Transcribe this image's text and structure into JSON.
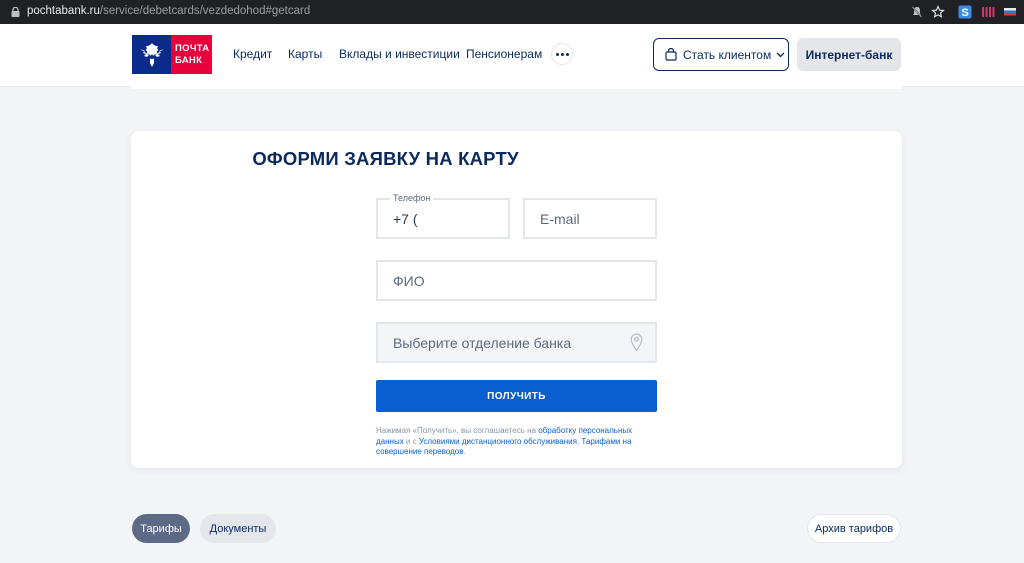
{
  "browser": {
    "url_host": "pochtabank.ru",
    "url_path": "/service/debetcards/vezdedohod#getcard"
  },
  "header": {
    "logo_line1": "ПОЧТА",
    "logo_line2": "БАНК",
    "nav": [
      "Кредит",
      "Карты",
      "Вклады и инвестиции",
      "Пенсионерам"
    ],
    "become_client": "Стать клиентом",
    "internet_bank": "Интернет-банк"
  },
  "form": {
    "title": "ОФОРМИ ЗАЯВКУ НА КАРТУ",
    "phone_label": "Телефон",
    "phone_value": "+7 (",
    "email_placeholder": "E-mail",
    "name_placeholder": "ФИО",
    "branch_placeholder": "Выберите отделение банка",
    "submit_label": "ПОЛУЧИТЬ",
    "consent": {
      "t1": "Нажимая «Получить», вы соглашаетесь на ",
      "l1": "обработку персональных данных",
      "t2": " и с ",
      "l2": "Условиями дистанционного обслуживания",
      "t3": ", ",
      "l3": "Тарифами на совершение переводов",
      "t4": "."
    }
  },
  "tabs": {
    "tariffs": "Тарифы",
    "documents": "Документы",
    "archive": "Архив тарифов"
  },
  "colors": {
    "brand_navy": "#0a2a5e",
    "brand_red": "#e8003d",
    "accent_blue": "#0a5fd0"
  }
}
